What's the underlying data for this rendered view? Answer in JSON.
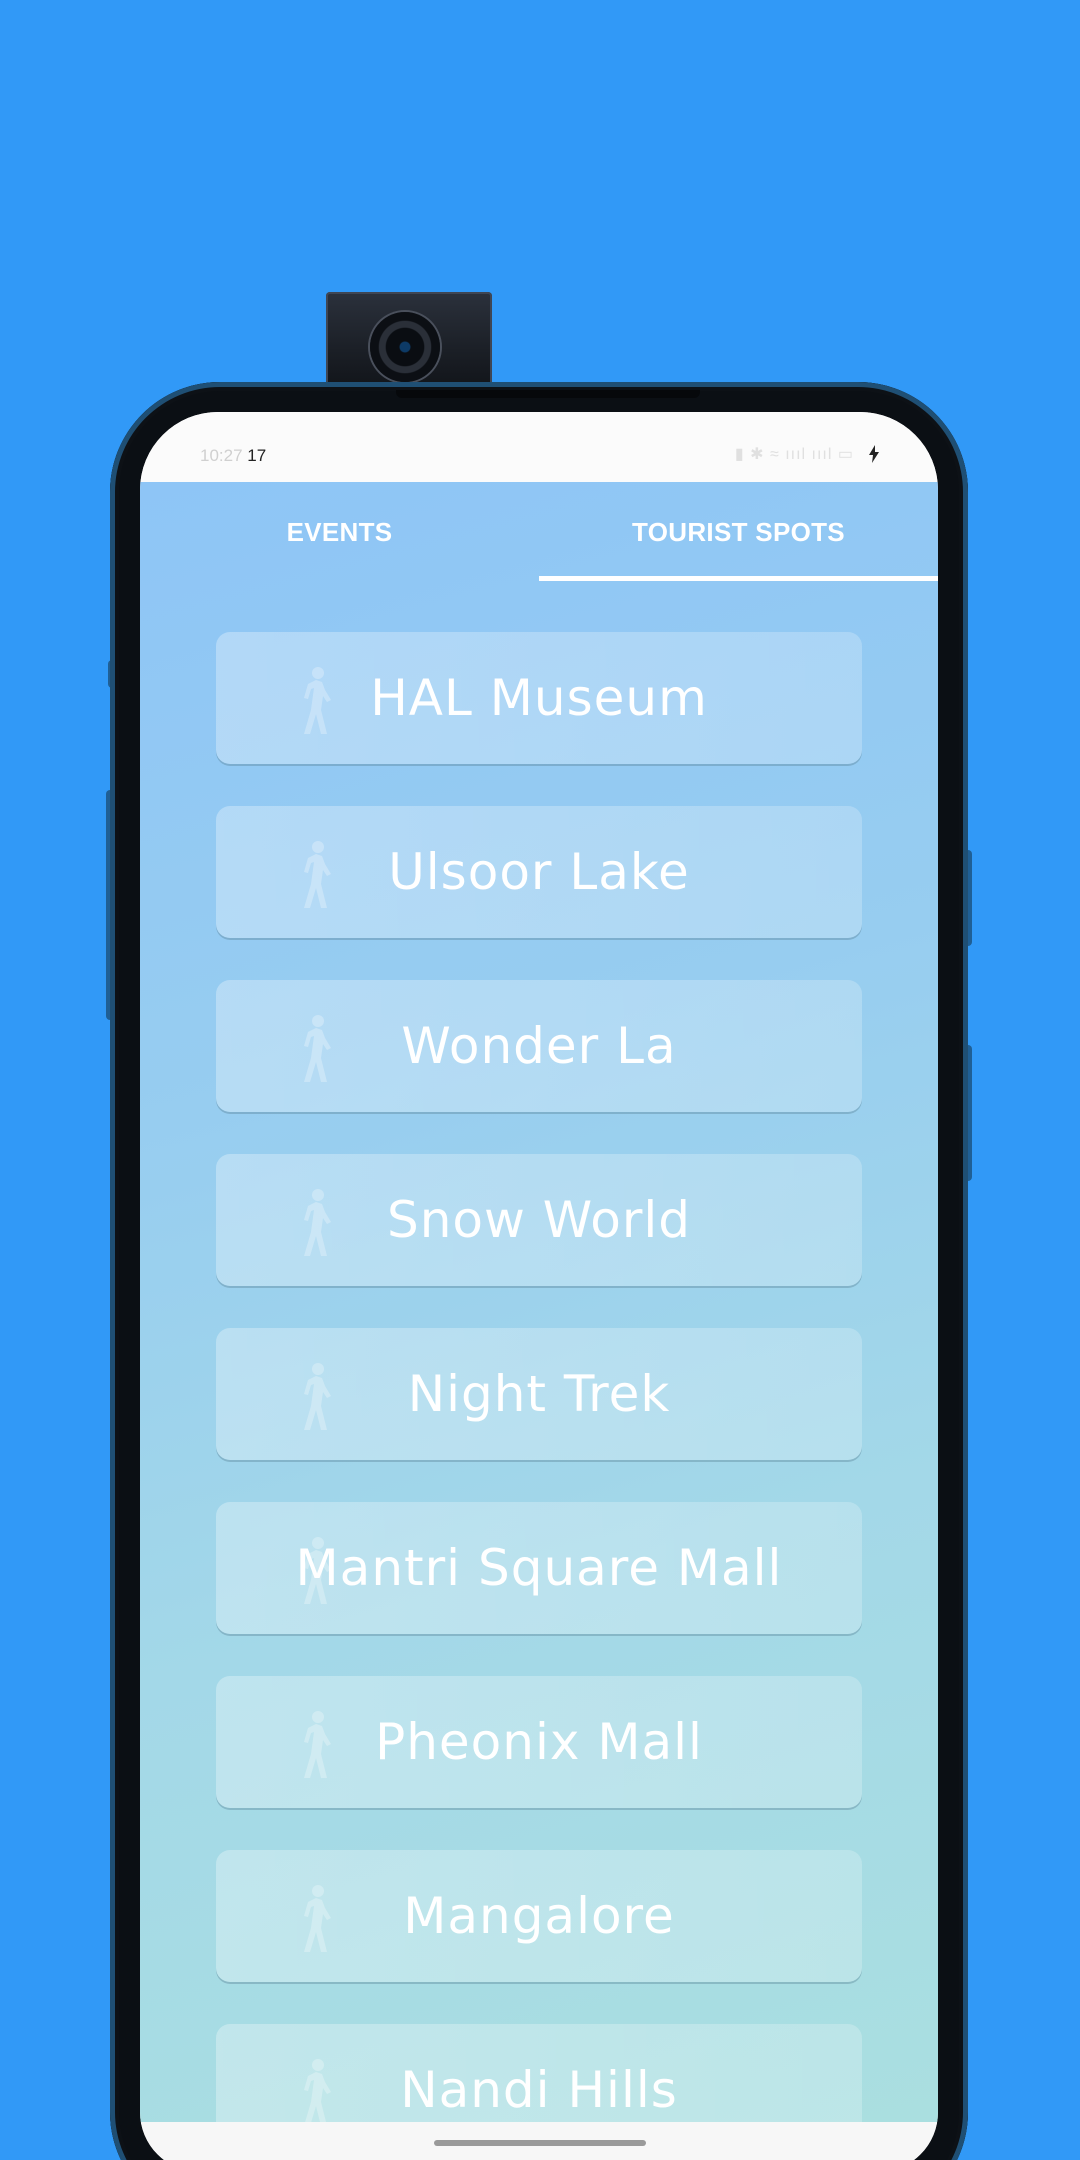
{
  "status_bar": {
    "time": "17"
  },
  "tabs": [
    {
      "label": "EVENTS",
      "selected": false
    },
    {
      "label": "TOURIST SPOTS",
      "selected": true
    }
  ],
  "spots": [
    {
      "name": "HAL Museum",
      "icon": "walking-person-icon"
    },
    {
      "name": "Ulsoor Lake",
      "icon": "walking-person-icon"
    },
    {
      "name": "Wonder La",
      "icon": "walking-person-icon"
    },
    {
      "name": "Snow World",
      "icon": "walking-person-icon"
    },
    {
      "name": "Night Trek",
      "icon": "walking-person-icon"
    },
    {
      "name": "Mantri Square Mall",
      "icon": "walking-person-icon"
    },
    {
      "name": "Pheonix Mall",
      "icon": "walking-person-icon"
    },
    {
      "name": "Mangalore",
      "icon": "walking-person-icon"
    },
    {
      "name": "Nandi Hills",
      "icon": "walking-person-icon"
    }
  ],
  "colors": {
    "background": "#3199F7",
    "app_gradient_top": "#8ec5f6",
    "app_gradient_bottom": "#aadfe0",
    "text": "#ffffff"
  }
}
